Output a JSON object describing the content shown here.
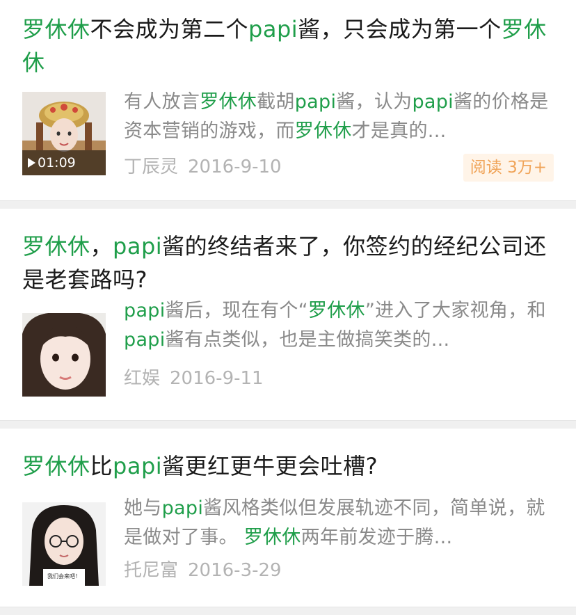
{
  "articles": [
    {
      "title_parts": [
        {
          "text": "罗休休",
          "hl": true
        },
        {
          "text": "不会成为第二个",
          "hl": false
        },
        {
          "text": "papi",
          "hl": true
        },
        {
          "text": "酱，只会成为第一个",
          "hl": false
        },
        {
          "text": "罗休休",
          "hl": true
        }
      ],
      "summary_parts": [
        {
          "text": "有人放言",
          "hl": false
        },
        {
          "text": "罗休休",
          "hl": true
        },
        {
          "text": "截胡",
          "hl": false
        },
        {
          "text": "papi",
          "hl": true
        },
        {
          "text": "酱，认为",
          "hl": false
        },
        {
          "text": "papi",
          "hl": true
        },
        {
          "text": "酱的价格是资本营销的游戏，而",
          "hl": false
        },
        {
          "text": "罗休休",
          "hl": true
        },
        {
          "text": "才是真的...",
          "hl": false
        }
      ],
      "author": "丁辰灵",
      "date": "2016-9-10",
      "video_duration": "01:09",
      "reads": "阅读 3万+"
    },
    {
      "title_parts": [
        {
          "text": "罗休休",
          "hl": true
        },
        {
          "text": "，",
          "hl": false
        },
        {
          "text": "papi",
          "hl": true
        },
        {
          "text": "酱的终结者来了，你签约的经纪公司还是老套路吗?",
          "hl": false
        }
      ],
      "summary_parts": [
        {
          "text": "papi",
          "hl": true
        },
        {
          "text": "酱后，现在有个“",
          "hl": false
        },
        {
          "text": "罗休休",
          "hl": true
        },
        {
          "text": "”进入了大家视角，和",
          "hl": false
        },
        {
          "text": "papi",
          "hl": true
        },
        {
          "text": "酱有点类似，也是主做搞笑类的...",
          "hl": false
        }
      ],
      "author": "红娱",
      "date": "2016-9-11"
    },
    {
      "title_parts": [
        {
          "text": "罗休休",
          "hl": true
        },
        {
          "text": "比",
          "hl": false
        },
        {
          "text": "papi",
          "hl": true
        },
        {
          "text": "酱更红更牛更会吐槽?",
          "hl": false
        }
      ],
      "summary_parts": [
        {
          "text": "她与",
          "hl": false
        },
        {
          "text": "papi",
          "hl": true
        },
        {
          "text": "酱风格类似但发展轨迹不同，简单说，就是做对了事。 ",
          "hl": false
        },
        {
          "text": "罗休休",
          "hl": true
        },
        {
          "text": "两年前发迹于腾...",
          "hl": false
        }
      ],
      "author": "托尼富",
      "date": "2016-3-29",
      "thumb_caption": "我们会来吧！"
    }
  ],
  "colors": {
    "highlight": "#1f9e4a",
    "title": "#1a1a1a",
    "summary": "#8a8a8a",
    "meta": "#b3b3b3",
    "reads_bg": "#fff4e8",
    "reads_text": "#f0a357",
    "separator": "#f0f0f0"
  }
}
